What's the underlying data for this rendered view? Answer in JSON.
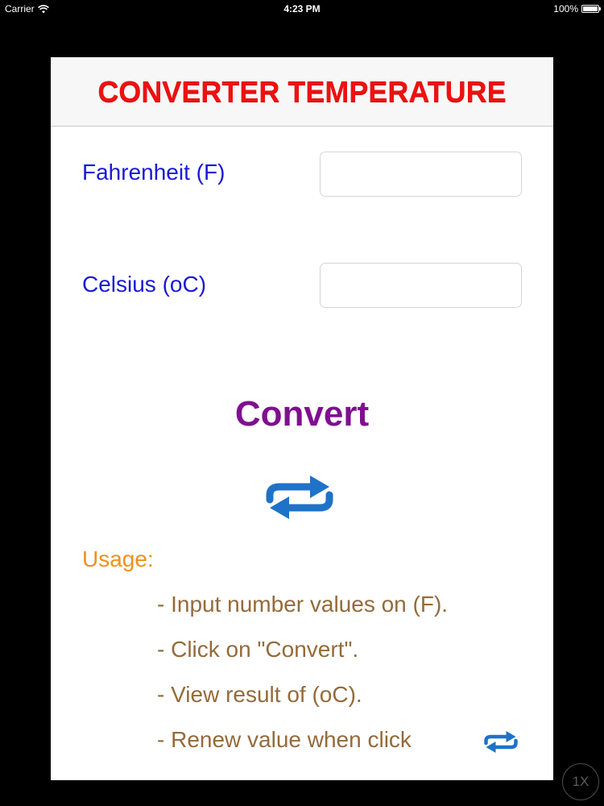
{
  "status_bar": {
    "carrier": "Carrier",
    "time": "4:23 PM",
    "battery": "100%"
  },
  "header": {
    "title": "CONVERTER TEMPERATURE"
  },
  "fields": {
    "fahrenheit": {
      "label": "Fahrenheit (F)",
      "value": "",
      "placeholder": ""
    },
    "celsius": {
      "label": "Celsius (oC)",
      "value": "",
      "placeholder": ""
    }
  },
  "actions": {
    "convert_label": "Convert",
    "renew_icon": "repeat-arrows-icon"
  },
  "usage": {
    "title": "Usage:",
    "lines": [
      "- Input number values on (F).",
      "- Click on \"Convert\".",
      "- View result of (oC).",
      "- Renew value when click"
    ]
  },
  "zoom": {
    "label": "1X"
  },
  "colors": {
    "title_red": "#ee1111",
    "label_blue": "#1a1ad6",
    "convert_purple": "#7f0f90",
    "usage_orange": "#f0901c",
    "usage_brown": "#956a3a",
    "icon_blue": "#1e72c8"
  }
}
